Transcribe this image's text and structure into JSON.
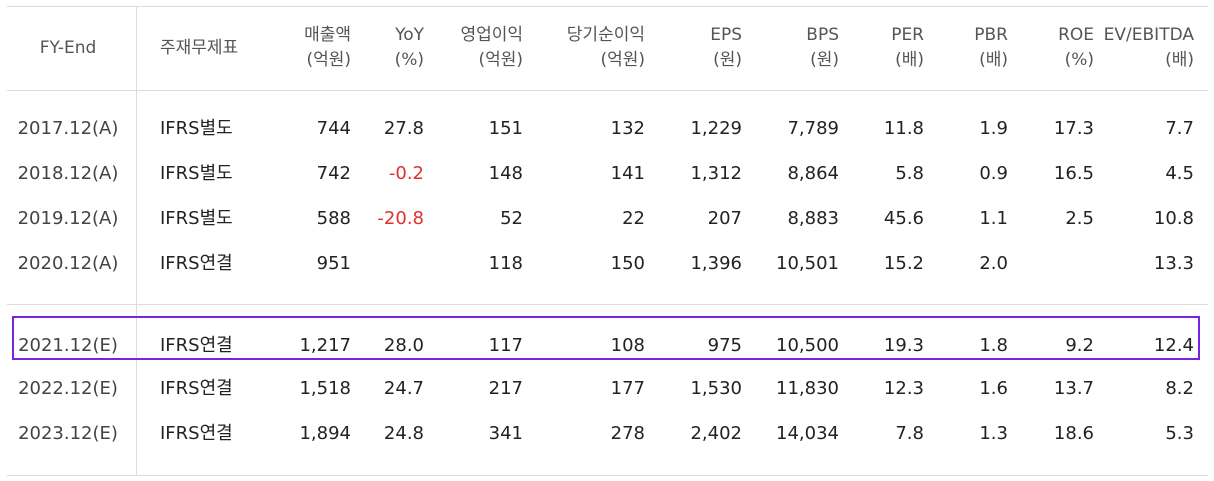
{
  "headers": {
    "fy": "FY-End",
    "type": "주재무제표",
    "cols": [
      {
        "l1": "매출액",
        "l2": "(억원)"
      },
      {
        "l1": "YoY",
        "l2": "(%)"
      },
      {
        "l1": "영업이익",
        "l2": "(억원)"
      },
      {
        "l1": "당기순이익",
        "l2": "(억원)"
      },
      {
        "l1": "EPS",
        "l2": "(원)"
      },
      {
        "l1": "BPS",
        "l2": "(원)"
      },
      {
        "l1": "PER",
        "l2": "(배)"
      },
      {
        "l1": "PBR",
        "l2": "(배)"
      },
      {
        "l1": "ROE",
        "l2": "(%)"
      },
      {
        "l1": "EV/EBITDA",
        "l2": "(배)"
      }
    ]
  },
  "rows": [
    {
      "fy": "2017.12(A)",
      "type": "IFRS별도",
      "v": [
        "744",
        "27.8",
        "151",
        "132",
        "1,229",
        "7,789",
        "11.8",
        "1.9",
        "17.3",
        "7.7"
      ]
    },
    {
      "fy": "2018.12(A)",
      "type": "IFRS별도",
      "v": [
        "742",
        "-0.2",
        "148",
        "141",
        "1,312",
        "8,864",
        "5.8",
        "0.9",
        "16.5",
        "4.5"
      ]
    },
    {
      "fy": "2019.12(A)",
      "type": "IFRS별도",
      "v": [
        "588",
        "-20.8",
        "52",
        "22",
        "207",
        "8,883",
        "45.6",
        "1.1",
        "2.5",
        "10.8"
      ]
    },
    {
      "fy": "2020.12(A)",
      "type": "IFRS연결",
      "v": [
        "951",
        "",
        "118",
        "150",
        "1,396",
        "10,501",
        "15.2",
        "2.0",
        "",
        "13.3"
      ]
    },
    {
      "fy": "2021.12(E)",
      "type": "IFRS연결",
      "v": [
        "1,217",
        "28.0",
        "117",
        "108",
        "975",
        "10,500",
        "19.3",
        "1.8",
        "9.2",
        "12.4"
      ]
    },
    {
      "fy": "2022.12(E)",
      "type": "IFRS연결",
      "v": [
        "1,518",
        "24.7",
        "217",
        "177",
        "1,530",
        "11,830",
        "12.3",
        "1.6",
        "13.7",
        "8.2"
      ]
    },
    {
      "fy": "2023.12(E)",
      "type": "IFRS연결",
      "v": [
        "1,894",
        "24.8",
        "341",
        "278",
        "2,402",
        "14,034",
        "7.8",
        "1.3",
        "18.6",
        "5.3"
      ]
    }
  ],
  "colors": {
    "negative": "#e03030",
    "highlight": "#7b22e0"
  }
}
